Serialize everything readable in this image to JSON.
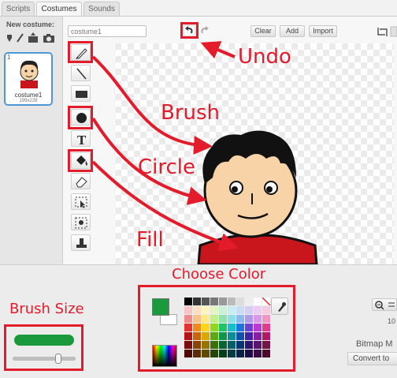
{
  "tabs": [
    {
      "label": "Scripts"
    },
    {
      "label": "Costumes"
    },
    {
      "label": "Sounds"
    }
  ],
  "sidebar": {
    "new_costume_label": "New costume:",
    "costume": {
      "index": "1",
      "name": "costume1",
      "size": "199x228"
    }
  },
  "editor": {
    "costume_name_value": "costume1",
    "clear_label": "Clear",
    "add_label": "Add",
    "import_label": "Import"
  },
  "footer": {
    "zoom_value": "10",
    "bitmap_mode_text": "Bitmap M",
    "convert_label": "Convert to"
  },
  "annotations": {
    "undo": "Undo",
    "brush": "Brush",
    "circle": "Circle",
    "fill": "Fill",
    "choose_color": "Choose Color",
    "brush_size": "Brush Size"
  },
  "colors": {
    "annotation_red": "#e31b2b",
    "primary_color": "#1a9a3c",
    "secondary_color": "#ffffff",
    "shirt": "#c8161c",
    "skin": "#f9d3a8"
  },
  "brush_size": {
    "fraction": 0.72
  },
  "tools": [
    "brush-icon",
    "line-icon",
    "rectangle-icon",
    "ellipse-icon",
    "text-icon",
    "fill-icon",
    "eraser-icon",
    "select-icon",
    "select-remove-background-icon",
    "stamp-icon"
  ],
  "palette": [
    [
      "#000000",
      "#333333",
      "#555555",
      "#777777",
      "#999999",
      "#bbbbbb",
      "#dddddd",
      "#eeeeee",
      "#ffffff",
      "none"
    ],
    [
      "#f6c5c5",
      "#fbe0c4",
      "#fff5c2",
      "#e2f7c4",
      "#c9f2d6",
      "#c6eef2",
      "#c8dcf6",
      "#d6cdf4",
      "#ecccf3",
      "#f7cbe1"
    ],
    [
      "#ee8c8c",
      "#f7c18a",
      "#ffea85",
      "#c3ee88",
      "#90e3ae",
      "#8cdee7",
      "#8fb8ee",
      "#ae9bea",
      "#d899e8",
      "#ef97c4"
    ],
    [
      "#e23232",
      "#f08a1a",
      "#ffd61a",
      "#8fd81d",
      "#1fc46a",
      "#16bfd0",
      "#1c74e0",
      "#6a42d8",
      "#b93ad6",
      "#e03c8f"
    ],
    [
      "#b51414",
      "#c9650c",
      "#d9a800",
      "#5ea80f",
      "#0f954c",
      "#0b8e9c",
      "#1150ac",
      "#4222a8",
      "#8a1ea6",
      "#ad1966"
    ],
    [
      "#7a0c0c",
      "#8a430a",
      "#967400",
      "#3d700a",
      "#0a6333",
      "#075f69",
      "#0a3574",
      "#2c1572",
      "#5c1370",
      "#751246"
    ],
    [
      "#4d0707",
      "#5a2b06",
      "#5f4a00",
      "#264607",
      "#063e20",
      "#043c42",
      "#062248",
      "#1b0d48",
      "#3a0b47",
      "#4a0b2c"
    ]
  ]
}
